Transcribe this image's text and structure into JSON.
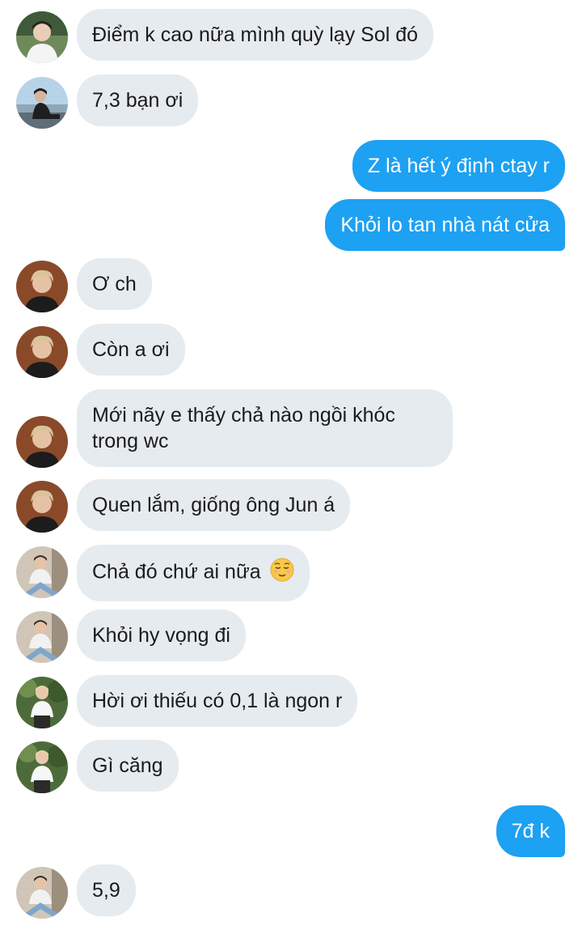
{
  "messages": [
    {
      "id": "m1",
      "side": "in",
      "avatar": "avatar-boy-white-shirt",
      "text": "Điểm k cao nữa mình quỳ lạy Sol đó"
    },
    {
      "id": "m2",
      "side": "in",
      "avatar": "avatar-boy-seaside",
      "text": "7,3 bạn ơi"
    },
    {
      "id": "m3",
      "side": "out",
      "text": "Z là hết ý định ctay r"
    },
    {
      "id": "m4",
      "side": "out",
      "text": "Khỏi lo tan nhà nát cửa"
    },
    {
      "id": "m5",
      "side": "in",
      "avatar": "avatar-boy-blonde",
      "text": "Ơ ch"
    },
    {
      "id": "m6",
      "side": "in",
      "avatar": "avatar-boy-blonde",
      "text": "Còn a ơi"
    },
    {
      "id": "m7",
      "side": "in",
      "avatar": "avatar-boy-blonde",
      "text": "Mới nãy e thấy chả nào ngồi khóc trong wc"
    },
    {
      "id": "m8",
      "side": "in",
      "avatar": "avatar-boy-blonde",
      "text": "Quen lắm, giống ông Jun á"
    },
    {
      "id": "m9",
      "side": "in",
      "avatar": "avatar-boy-sitting",
      "text": "Chả đó chứ ai nữa",
      "emoji": "relieved-face-icon"
    },
    {
      "id": "m10",
      "side": "in",
      "avatar": "avatar-boy-sitting",
      "text": "Khỏi hy vọng đi"
    },
    {
      "id": "m11",
      "side": "in",
      "avatar": "avatar-boy-outdoor",
      "text": "Hời ơi thiếu có 0,1 là ngon r"
    },
    {
      "id": "m12",
      "side": "in",
      "avatar": "avatar-boy-outdoor",
      "text": "Gì căng"
    },
    {
      "id": "m13",
      "side": "out",
      "text": "7đ k"
    },
    {
      "id": "m14",
      "side": "in",
      "avatar": "avatar-boy-sitting",
      "text": "5,9"
    }
  ],
  "colors": {
    "incoming_bubble": "#e6ebef",
    "outgoing_bubble": "#1da1f2",
    "outgoing_text": "#ffffff",
    "incoming_text": "#1b1b1b"
  }
}
